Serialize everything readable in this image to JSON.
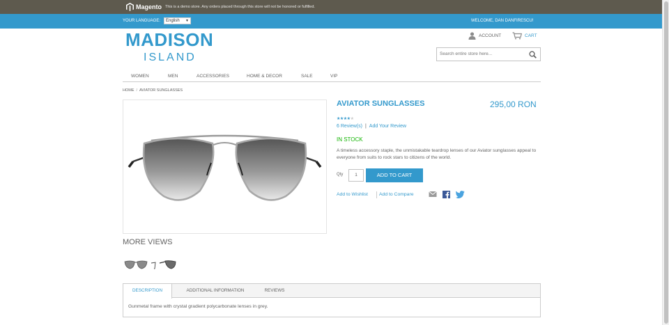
{
  "demo_bar": {
    "brand": "Magento",
    "notice": "This is a demo store. Any orders placed through this store will not be honored or fulfilled.",
    "bg_color": "#5e5a4e"
  },
  "header": {
    "language_label": "YOUR LANGUAGE:",
    "language_value": "English",
    "welcome": "WELCOME, DAN DANFIRESCU!",
    "bg_color": "#3399cc"
  },
  "logo": {
    "line1": "MADISON",
    "line2": "ISLAND"
  },
  "account": {
    "account_label": "ACCOUNT",
    "cart_label": "CART"
  },
  "search": {
    "placeholder": "Search entire store here..."
  },
  "nav": {
    "items": [
      "WOMEN",
      "MEN",
      "ACCESSORIES",
      "HOME & DECOR",
      "SALE",
      "VIP"
    ]
  },
  "breadcrumb": {
    "home": "HOME",
    "current": "AVIATOR SUNGLASSES"
  },
  "product": {
    "name": "AVIATOR SUNGLASSES",
    "price": "295,00 RON",
    "rating": 0.8,
    "reviews_link": "6 Review(s)",
    "add_review_link": "Add Your Review",
    "stock": "IN STOCK",
    "description": "A timeless accessory staple, the unmistakable teardrop lenses of our Aviator sunglasses appeal to everyone from suits to rock stars to citizens of the world.",
    "qty_label": "Qty",
    "qty_value": "1",
    "add_to_cart": "ADD TO CART",
    "wishlist_link": "Add to Wishlist",
    "compare_link": "Add to Compare",
    "accent_color": "#3399cc",
    "stock_color": "#11b400"
  },
  "more_views": {
    "title": "MORE VIEWS"
  },
  "tabs": {
    "items": [
      "DESCRIPTION",
      "ADDITIONAL INFORMATION",
      "REVIEWS"
    ],
    "active_content": "Gunmetal frame with crystal gradient polycarbonate lenses in grey."
  }
}
